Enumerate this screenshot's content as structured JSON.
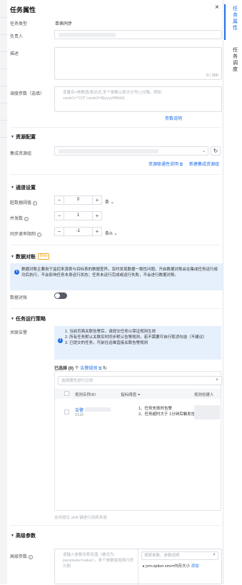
{
  "drawer": {
    "title": "任务属性",
    "close_icon": "close-icon"
  },
  "basic": {
    "task_type_label": "任务类型",
    "task_type_value": "单表同步",
    "owner_label": "负责人",
    "desc_label": "描述",
    "desc_counter": "0 / 300",
    "schedule_label": "调度参数（选填）",
    "schedule_placeholder": "变量名=参数值/表达式,多个参数以英文分号(;)分隔。例如 vaule1=\"123\";vaule2=${yyyyMMdd}",
    "param_help_link": "参数说明"
  },
  "resource": {
    "title": "资源配置",
    "group_label": "集成资源组",
    "conn_link": "资源联通性说明",
    "new_group_link": "新建集成资源组"
  },
  "channel": {
    "title": "通道设置",
    "dirty_label": "脏数据阈值",
    "dirty_value": "0",
    "dirty_unit": "条",
    "concurrency_label": "并发数",
    "concurrency_value": "1",
    "rate_label": "同步速率限制",
    "rate_value": "-1",
    "rate_unit": "条/s"
  },
  "reconcile": {
    "title": "数据对账",
    "badge": "Beta",
    "info_text": "数据对账主要用于监控来源表与目标表的数据差异，及时发现数据一致性问题。开启数据对账会在集成任务运行成功后执行，不会影响任务本身运行状态；任务未运行完成或运行失败，不会进行数据对账。",
    "toggle_label": "数据对账"
  },
  "strategy": {
    "title": "任务运行策略",
    "alarm_label": "关联告警",
    "tips": [
      "1. 当前页面关联告警后，请提交任务以保证规则生效",
      "2. 所有任务默认关联实时同步默认告警规则，若不需要可自行取消勾选（不建议）",
      "3. 已提交的任务，可前往运维直接关联告警规则"
    ],
    "selected_prefix": "已选择",
    "selected_count": "(0)",
    "selected_mid": "个",
    "alarm_rule_link": "告警规则",
    "search_placeholder": "选择属性进行过滤",
    "table_headers": [
      "规则名称/ID",
      "指标阈值",
      "规则创建人"
    ],
    "row_name": "告警",
    "row_id": "2110",
    "row_metrics": [
      "1、任务失败时告警",
      "2、任务超时大于 1分钟后触发告警"
    ],
    "footer_hint": "支持按住 shift 键进行连续多选"
  },
  "advanced": {
    "title": "高级参数",
    "label": "高级参数",
    "input_placeholder": "请输入参数名称及值（格式为: parameter=value），多个参数使用换行符分割",
    "search_placeholder": "搜索参数、参数说明",
    "param_item": "jvm.option.xmx=内存大小",
    "add_link": "添加"
  },
  "side_tabs": {
    "active": "任务属性",
    "other": "任务调度"
  },
  "colors": {
    "accent": "#1f6fe5",
    "info_bg": "#e6f0fd",
    "beta_badge": "#f5a623"
  }
}
